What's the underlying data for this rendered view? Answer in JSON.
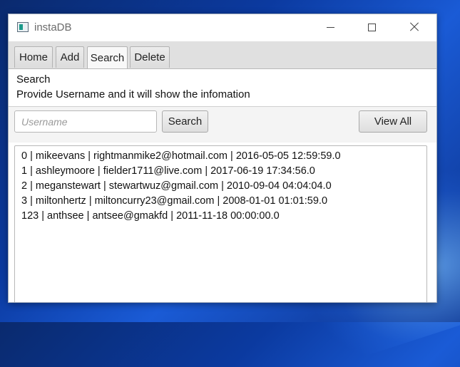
{
  "window": {
    "title": "instaDB"
  },
  "tabs": [
    {
      "label": "Home"
    },
    {
      "label": "Add"
    },
    {
      "label": "Search"
    },
    {
      "label": "Delete"
    }
  ],
  "info": {
    "title": "Search",
    "description": "Provide Username and it will show the infomation"
  },
  "search": {
    "placeholder": "Username",
    "value": "",
    "search_label": "Search",
    "view_all_label": "View All"
  },
  "results": [
    "0 | mikeevans | rightmanmike2@hotmail.com | 2016-05-05 12:59:59.0",
    "1 | ashleymoore | fielder1711@live.com | 2017-06-19 17:34:56.0",
    "2 | meganstewart | stewartwuz@gmail.com | 2010-09-04 04:04:04.0",
    "3 | miltonhertz | miltoncurry23@gmail.com | 2008-01-01 01:01:59.0",
    "123 | anthsee | antsee@gmakfd | 2011-11-18 00:00:00.0"
  ],
  "icons": {
    "app": "app-window-icon",
    "minimize": "minimize-icon",
    "maximize": "maximize-icon",
    "close": "close-icon"
  }
}
